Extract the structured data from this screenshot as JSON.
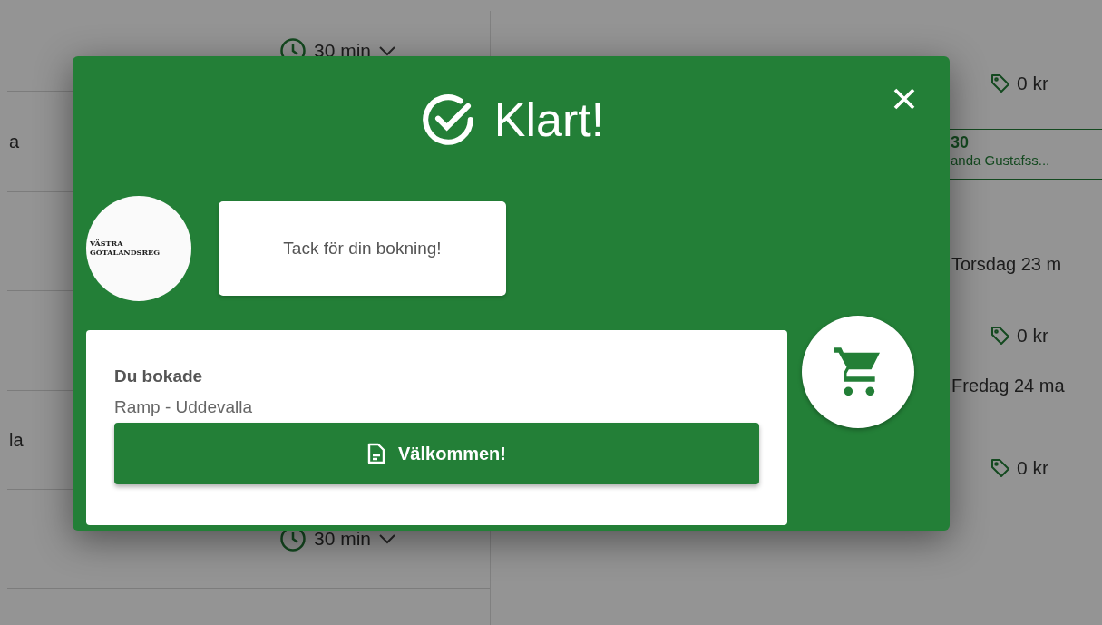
{
  "list_rows": [
    {
      "name": "",
      "duration": "30 min"
    },
    {
      "name": "a",
      "duration": ""
    },
    {
      "name": "",
      "duration": ""
    },
    {
      "name": "",
      "duration": ""
    },
    {
      "name": "la",
      "duration": ""
    },
    {
      "name": "",
      "duration": "30 min"
    }
  ],
  "detail_items": [
    {
      "kind": "price",
      "text": "0 kr"
    },
    {
      "kind": "slot",
      "time": "30",
      "person": "anda Gustafss..."
    },
    {
      "kind": "day",
      "text": "Torsdag 23 m"
    },
    {
      "kind": "price",
      "text": "0 kr"
    },
    {
      "kind": "day",
      "text": "Fredag 24 ma"
    },
    {
      "kind": "price",
      "text": "0 kr"
    }
  ],
  "dialog": {
    "title": "Klart!",
    "logo_lines": [
      "VÄSTRA",
      "GÖTALANDSREG"
    ],
    "message": "Tack för din bokning!",
    "booking_label": "Du bokade",
    "booking_item": "Ramp - Uddevalla",
    "button": "Välkommen!"
  }
}
